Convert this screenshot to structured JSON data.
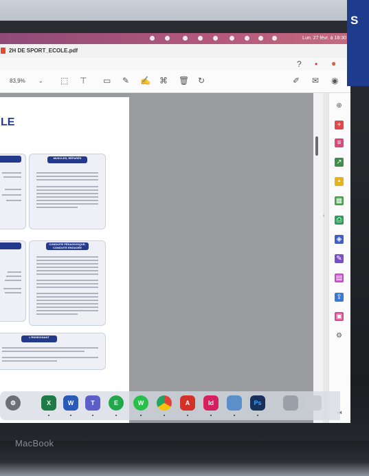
{
  "menubar": {
    "clock": "Lun. 27 févr. à 18:30"
  },
  "window": {
    "title": "2H DE SPORT_ECOLE.pdf"
  },
  "toolbar": {
    "zoom": "83,9%"
  },
  "page": {
    "heading": "LE",
    "cards": [
      {
        "header": ""
      },
      {
        "header": "MUSCLES, RÉPARÉS"
      },
      {
        "header": ""
      },
      {
        "header": "CONDUITE PÉDAGOGIQUE, CONDUITE ENGAGÉE"
      },
      {
        "header": "L'ENSEIGNANT"
      }
    ]
  },
  "laptop": {
    "brand": "MacBook"
  },
  "overlay": {
    "text": "S"
  },
  "rail_icons": [
    "zoom-icon",
    "add-pdf-icon",
    "organize-icon",
    "export-pdf-icon",
    "comment-icon",
    "spreadsheet-icon",
    "print-icon",
    "protect-icon",
    "fill-sign-icon",
    "create-pdf-icon",
    "share-icon",
    "compress-icon",
    "more-tools-icon"
  ],
  "dock_apps": [
    {
      "name": "system-preferences-icon",
      "label": "",
      "color": "#6d6f75"
    },
    {
      "name": "excel-icon",
      "label": "X",
      "color": "#1f7b45"
    },
    {
      "name": "word-icon",
      "label": "W",
      "color": "#2a5ab8"
    },
    {
      "name": "teams-icon",
      "label": "T",
      "color": "#5b5fc7"
    },
    {
      "name": "evernote-icon",
      "label": "E",
      "color": "#21a84b"
    },
    {
      "name": "whatsapp-icon",
      "label": "W",
      "color": "#29c04a"
    },
    {
      "name": "chrome-icon",
      "label": "",
      "color": "#e8a91a"
    },
    {
      "name": "acrobat-icon",
      "label": "A",
      "color": "#d3322b"
    },
    {
      "name": "indesign-icon",
      "label": "Id",
      "color": "#d61f5d"
    },
    {
      "name": "preview-icon",
      "label": "",
      "color": "#5b8fc9"
    },
    {
      "name": "photoshop-icon",
      "label": "Ps",
      "color": "#17305c"
    },
    {
      "name": "finder-window-icon",
      "label": "",
      "color": "#9aa0a8"
    },
    {
      "name": "trash-icon",
      "label": "",
      "color": "#c9ccd2"
    }
  ]
}
